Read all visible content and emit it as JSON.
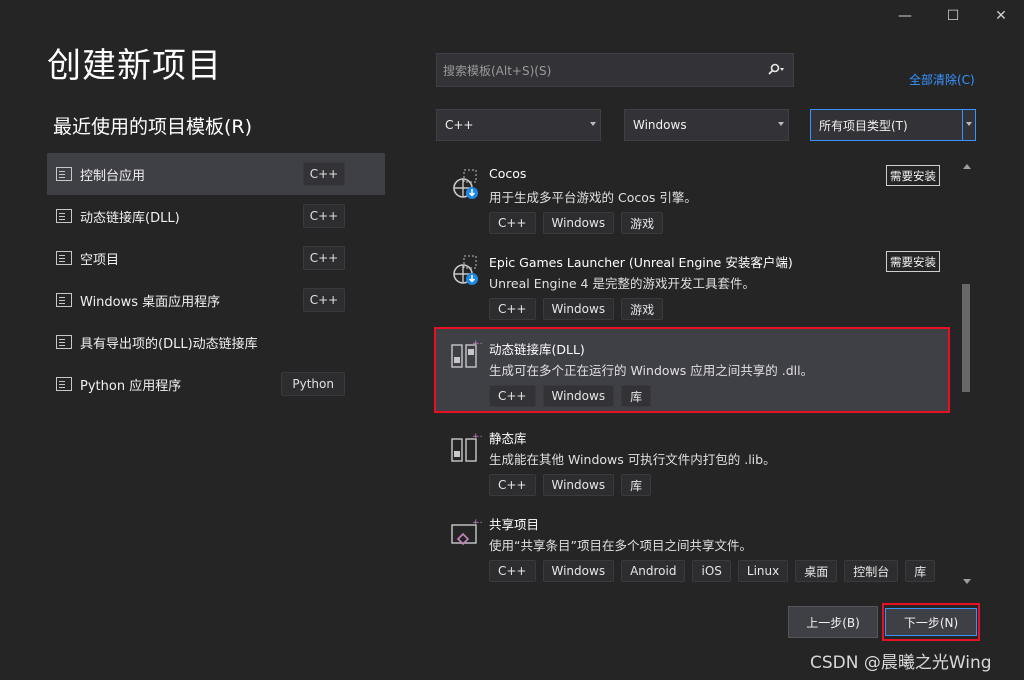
{
  "window": {
    "minimize_label": "—",
    "maximize_label": "☐",
    "close_label": "✕"
  },
  "page_title": "创建新项目",
  "recent": {
    "title": "最近使用的项目模板(R)",
    "items": [
      {
        "label": "控制台应用",
        "lang": "C++",
        "selected": true
      },
      {
        "label": "动态链接库(DLL)",
        "lang": "C++"
      },
      {
        "label": "空项目",
        "lang": "C++"
      },
      {
        "label": "Windows 桌面应用程序",
        "lang": "C++"
      },
      {
        "label": "具有导出项的(DLL)动态链接库",
        "lang": ""
      },
      {
        "label": "Python 应用程序",
        "lang": "Python"
      }
    ]
  },
  "search": {
    "placeholder": "搜索模板(Alt+S)(S)",
    "value": "",
    "icon": "search-icon"
  },
  "clear_all": "全部清除(C)",
  "filters": {
    "language": "C++",
    "platform": "Windows",
    "project_type": "所有项目类型(T)"
  },
  "templates": [
    {
      "name": "Cocos",
      "desc": "用于生成多平台游戏的 Cocos 引擎。",
      "tags": [
        "C++",
        "Windows",
        "游戏"
      ],
      "badge": "需要安装"
    },
    {
      "name": "Epic Games Launcher (Unreal Engine 安装客户端)",
      "desc": "Unreal Engine 4 是完整的游戏开发工具套件。",
      "tags": [
        "C++",
        "Windows",
        "游戏"
      ],
      "badge": "需要安装"
    },
    {
      "name": "动态链接库(DLL)",
      "desc": "生成可在多个正在运行的 Windows 应用之间共享的 .dll。",
      "tags": [
        "C++",
        "Windows",
        "库"
      ],
      "selected": true
    },
    {
      "name": "静态库",
      "desc": "生成能在其他 Windows 可执行文件内打包的 .lib。",
      "tags": [
        "C++",
        "Windows",
        "库"
      ]
    },
    {
      "name": "共享项目",
      "desc": "使用“共享条目”项目在多个项目之间共享文件。",
      "tags": [
        "C++",
        "Windows",
        "Android",
        "iOS",
        "Linux",
        "桌面",
        "控制台",
        "库"
      ]
    }
  ],
  "buttons": {
    "back": "上一步(B)",
    "next": "下一步(N)"
  },
  "watermark": "CSDN @晨曦之光Wing"
}
